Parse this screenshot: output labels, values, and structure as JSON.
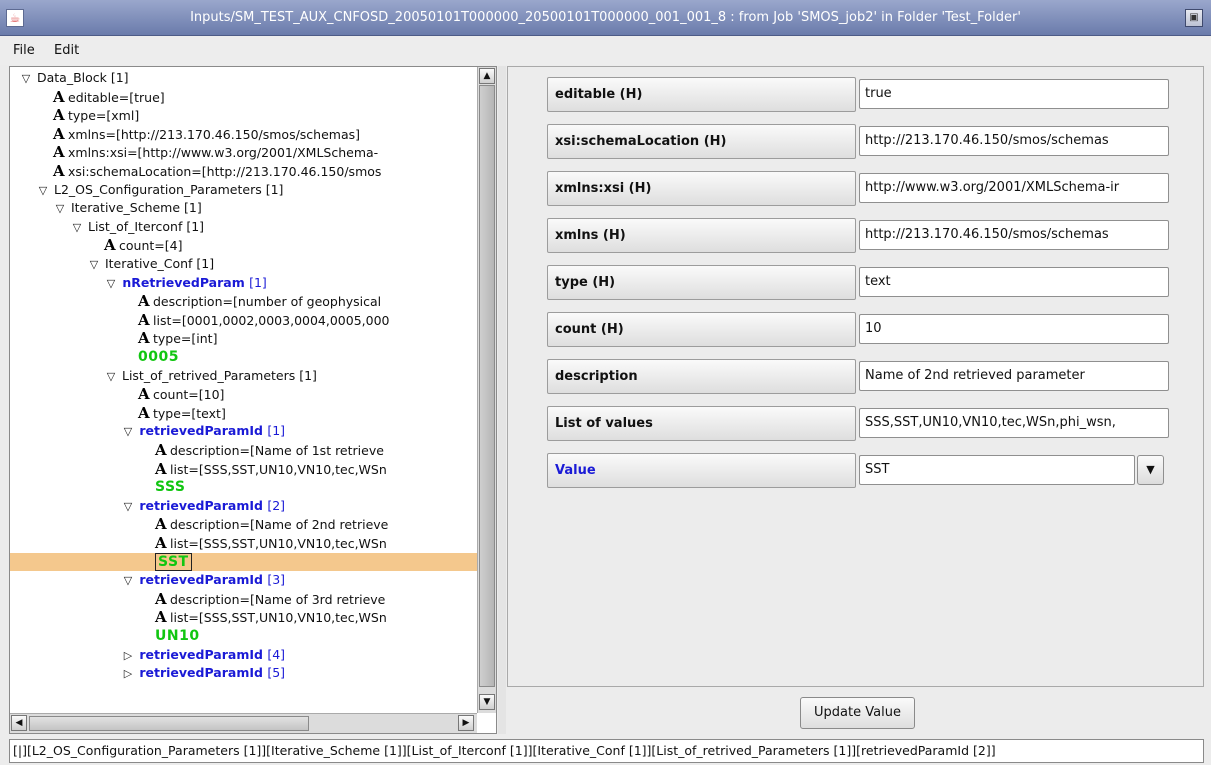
{
  "window": {
    "title": "Inputs/SM_TEST_AUX_CNFOSD_20050101T000000_20500101T000000_001_001_8 : from Job 'SMOS_job2' in Folder 'Test_Folder'"
  },
  "menu": [
    "File",
    "Edit"
  ],
  "tree": [
    {
      "indent": 1,
      "kind": "node",
      "expanded": true,
      "text": "Data_Block [1]"
    },
    {
      "indent": 3,
      "kind": "attr",
      "text": "editable=[true]"
    },
    {
      "indent": 3,
      "kind": "attr",
      "text": "type=[xml]"
    },
    {
      "indent": 3,
      "kind": "attr",
      "text": "xmlns=[http://213.170.46.150/smos/schemas]"
    },
    {
      "indent": 3,
      "kind": "attr",
      "text": "xmlns:xsi=[http://www.w3.org/2001/XMLSchema-"
    },
    {
      "indent": 3,
      "kind": "attr",
      "text": "xsi:schemaLocation=[http://213.170.46.150/smos"
    },
    {
      "indent": 2,
      "kind": "node",
      "expanded": true,
      "text": "L2_OS_Configuration_Parameters [1]"
    },
    {
      "indent": 3,
      "kind": "node",
      "expanded": true,
      "text": "Iterative_Scheme [1]"
    },
    {
      "indent": 4,
      "kind": "node",
      "expanded": true,
      "text": "List_of_Iterconf [1]"
    },
    {
      "indent": 6,
      "kind": "attr",
      "text": "count=[4]"
    },
    {
      "indent": 5,
      "kind": "node",
      "expanded": true,
      "text": "Iterative_Conf [1]"
    },
    {
      "indent": 6,
      "kind": "node",
      "expanded": true,
      "bold": true,
      "name": "nRetrievedParam",
      "suffix": "[1]"
    },
    {
      "indent": 8,
      "kind": "attr",
      "text": "description=[number of geophysical"
    },
    {
      "indent": 8,
      "kind": "attr",
      "text": "list=[0001,0002,0003,0004,0005,000"
    },
    {
      "indent": 8,
      "kind": "attr",
      "text": "type=[int]"
    },
    {
      "indent": 8,
      "kind": "value",
      "text": "0005"
    },
    {
      "indent": 6,
      "kind": "node",
      "expanded": true,
      "text": "List_of_retrived_Parameters [1]"
    },
    {
      "indent": 8,
      "kind": "attr",
      "text": "count=[10]"
    },
    {
      "indent": 8,
      "kind": "attr",
      "text": "type=[text]"
    },
    {
      "indent": 7,
      "kind": "node",
      "expanded": true,
      "bold": true,
      "name": "retrievedParamId",
      "suffix": "[1]"
    },
    {
      "indent": 9,
      "kind": "attr",
      "text": "description=[Name of 1st retrieve"
    },
    {
      "indent": 9,
      "kind": "attr",
      "text": "list=[SSS,SST,UN10,VN10,tec,WSn"
    },
    {
      "indent": 9,
      "kind": "value",
      "text": "SSS"
    },
    {
      "indent": 7,
      "kind": "node",
      "expanded": true,
      "bold": true,
      "name": "retrievedParamId",
      "suffix": "[2]"
    },
    {
      "indent": 9,
      "kind": "attr",
      "text": "description=[Name of 2nd retrieve"
    },
    {
      "indent": 9,
      "kind": "attr",
      "text": "list=[SSS,SST,UN10,VN10,tec,WSn"
    },
    {
      "indent": 9,
      "kind": "value",
      "text": "SST",
      "selected": true
    },
    {
      "indent": 7,
      "kind": "node",
      "expanded": true,
      "bold": true,
      "name": "retrievedParamId",
      "suffix": "[3]"
    },
    {
      "indent": 9,
      "kind": "attr",
      "text": "description=[Name of 3rd retrieve"
    },
    {
      "indent": 9,
      "kind": "attr",
      "text": "list=[SSS,SST,UN10,VN10,tec,WSn"
    },
    {
      "indent": 9,
      "kind": "value",
      "text": "UN10"
    },
    {
      "indent": 7,
      "kind": "node",
      "expanded": false,
      "bold": true,
      "name": "retrievedParamId",
      "suffix": "[4]"
    },
    {
      "indent": 7,
      "kind": "node",
      "expanded": false,
      "bold": true,
      "name": "retrievedParamId",
      "suffix": "[5]"
    }
  ],
  "form": {
    "fields": [
      {
        "label": "editable (H)",
        "value": "true"
      },
      {
        "label": "xsi:schemaLocation (H)",
        "value": "http://213.170.46.150/smos/schemas"
      },
      {
        "label": "xmlns:xsi (H)",
        "value": "http://www.w3.org/2001/XMLSchema-ir"
      },
      {
        "label": "xmlns (H)",
        "value": "http://213.170.46.150/smos/schemas"
      },
      {
        "label": "type (H)",
        "value": "text"
      },
      {
        "label": "count (H)",
        "value": "10"
      },
      {
        "label": "description",
        "value": "Name of 2nd retrieved parameter"
      },
      {
        "label": "List of values",
        "value": "SSS,SST,UN10,VN10,tec,WSn,phi_wsn,"
      }
    ],
    "value_field": {
      "label": "Value",
      "value": "SST"
    },
    "update_button": "Update Value"
  },
  "status_path": "[|][L2_OS_Configuration_Parameters [1]][Iterative_Scheme [1]][List_of_Iterconf [1]][Iterative_Conf [1]][List_of_retrived_Parameters [1]][retrievedParamId [2]]",
  "colors": {
    "selection": "#f4c88d",
    "value_green": "#11c611",
    "element_blue": "#1a1ad6",
    "titlebar": "#7c8bb8"
  }
}
